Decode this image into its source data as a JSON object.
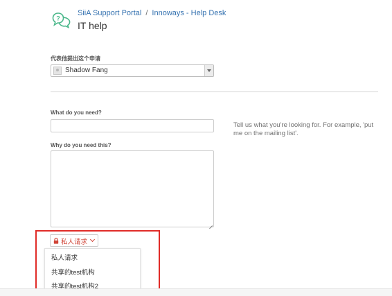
{
  "header": {
    "portal_link": "SiiA Support Portal",
    "separator": "/",
    "desk_link": "Innoways - Help Desk",
    "title": "IT help"
  },
  "form": {
    "on_behalf": {
      "label": "代表他提出这个申请",
      "value": "Shadow Fang"
    },
    "need": {
      "label": "What do you need?",
      "value": "",
      "help": "Tell us what you're looking for. For example, 'put me on the mailing list'."
    },
    "why": {
      "label": "Why do you need this?",
      "value": ""
    }
  },
  "share": {
    "selected": "私人请求",
    "options": [
      "私人请求",
      "共享的test机构",
      "共享的test机构2"
    ]
  },
  "colors": {
    "link": "#3572b0",
    "accent_red": "#d04437",
    "portal_icon": "#4cb88b",
    "highlight": "#e02b27"
  },
  "icons": {
    "portal": "chat-help-icon",
    "lock": "lock-icon",
    "chevron": "chevron-down-icon",
    "avatar": "default-avatar"
  }
}
